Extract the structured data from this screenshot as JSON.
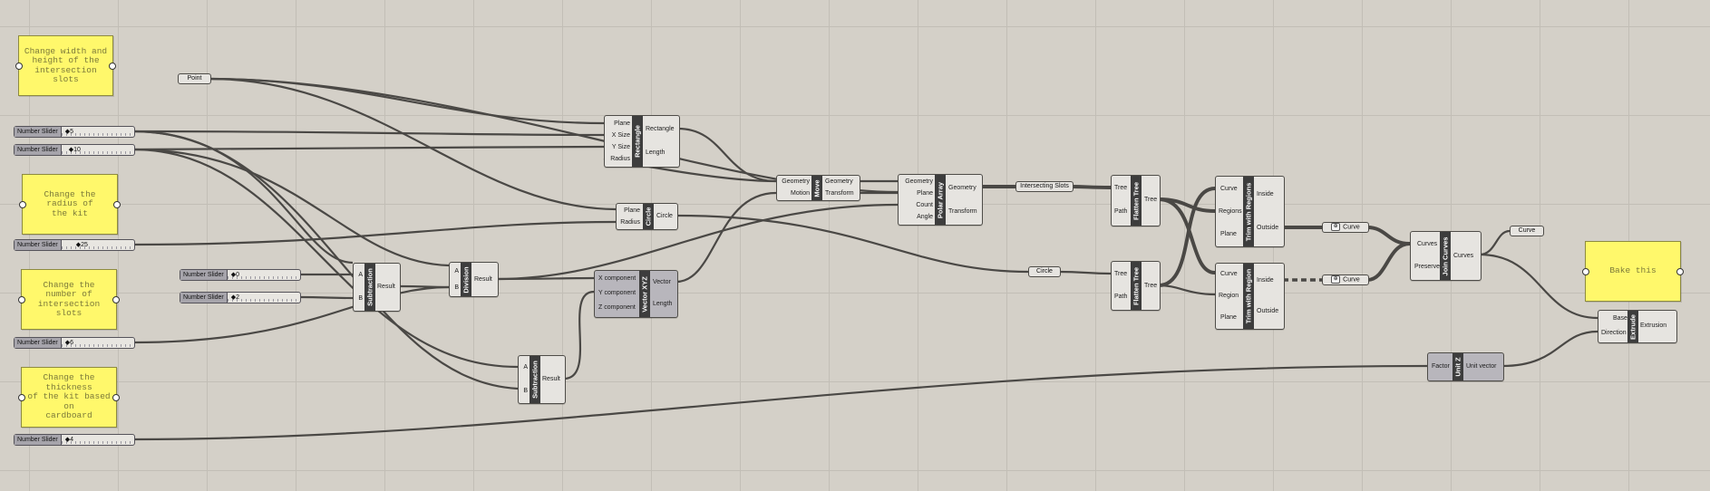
{
  "notes": [
    {
      "id": "note-slot-size",
      "text": "Change width and\nheight of the\nintersection slots"
    },
    {
      "id": "note-radius",
      "text": "Change the radius of\nthe kit"
    },
    {
      "id": "note-slot-count",
      "text": "Change the number of\nintersection slots"
    },
    {
      "id": "note-thickness",
      "text": "Change the thickness\nof the kit based on\ncardboard"
    },
    {
      "id": "note-bake",
      "text": "Bake this"
    }
  ],
  "sliders": [
    {
      "label": "Number Slider",
      "value": "◆5"
    },
    {
      "label": "Number Slider",
      "value": "◆10"
    },
    {
      "label": "Number Slider",
      "value": "◆25"
    },
    {
      "label": "Number Slider",
      "value": "◆0"
    },
    {
      "label": "Number Slider",
      "value": "◆2"
    },
    {
      "label": "Number Slider",
      "value": "◆6"
    },
    {
      "label": "Number Slider",
      "value": "◆4"
    }
  ],
  "params": {
    "point": "Point",
    "intersecting_slots": "Intersecting Slots",
    "circle": "Circle",
    "curve_a": "Curve",
    "curve_b": "Curve",
    "curve_c": "Curve"
  },
  "components": {
    "rectangle": {
      "title": "Rectangle",
      "inputs": [
        "Plane",
        "X Size",
        "Y Size",
        "Radius"
      ],
      "outputs": [
        "Rectangle",
        "Length"
      ]
    },
    "circle": {
      "title": "Circle",
      "inputs": [
        "Plane",
        "Radius"
      ],
      "outputs": [
        "Circle"
      ]
    },
    "subtraction1": {
      "title": "Subtraction",
      "inputs": [
        "A",
        "B"
      ],
      "outputs": [
        "Result"
      ]
    },
    "division": {
      "title": "Division",
      "inputs": [
        "A",
        "B"
      ],
      "outputs": [
        "Result"
      ]
    },
    "subtraction2": {
      "title": "Subtraction",
      "inputs": [
        "A",
        "B"
      ],
      "outputs": [
        "Result"
      ]
    },
    "vector_xyz": {
      "title": "Vector XYZ",
      "inputs": [
        "X component",
        "Y component",
        "Z component"
      ],
      "outputs": [
        "Vector",
        "Length"
      ]
    },
    "move": {
      "title": "Move",
      "inputs": [
        "Geometry",
        "Motion"
      ],
      "outputs": [
        "Geometry",
        "Transform"
      ]
    },
    "polar_array": {
      "title": "Polar Array",
      "inputs": [
        "Geometry",
        "Plane",
        "Count",
        "Angle"
      ],
      "outputs": [
        "Geometry",
        "Transform"
      ]
    },
    "flatten1": {
      "title": "Flatten Tree",
      "inputs": [
        "Tree",
        "Path"
      ],
      "outputs": [
        "Tree"
      ]
    },
    "flatten2": {
      "title": "Flatten Tree",
      "inputs": [
        "Tree",
        "Path"
      ],
      "outputs": [
        "Tree"
      ]
    },
    "trim_regions": {
      "title": "Trim with Regions",
      "inputs": [
        "Curve",
        "Regions",
        "Plane"
      ],
      "outputs": [
        "Inside",
        "Outside"
      ]
    },
    "trim_region": {
      "title": "Trim with Region",
      "inputs": [
        "Curve",
        "Region",
        "Plane"
      ],
      "outputs": [
        "Inside",
        "Outside"
      ]
    },
    "join_curves": {
      "title": "Join Curves",
      "inputs": [
        "Curves",
        "Preserve"
      ],
      "outputs": [
        "Curves"
      ]
    },
    "unit_z": {
      "title": "Unit Z",
      "inputs": [
        "Factor"
      ],
      "outputs": [
        "Unit vector"
      ]
    },
    "extrude": {
      "title": "Extrude",
      "inputs": [
        "Base",
        "Direction"
      ],
      "outputs": [
        "Extrusion"
      ]
    }
  }
}
